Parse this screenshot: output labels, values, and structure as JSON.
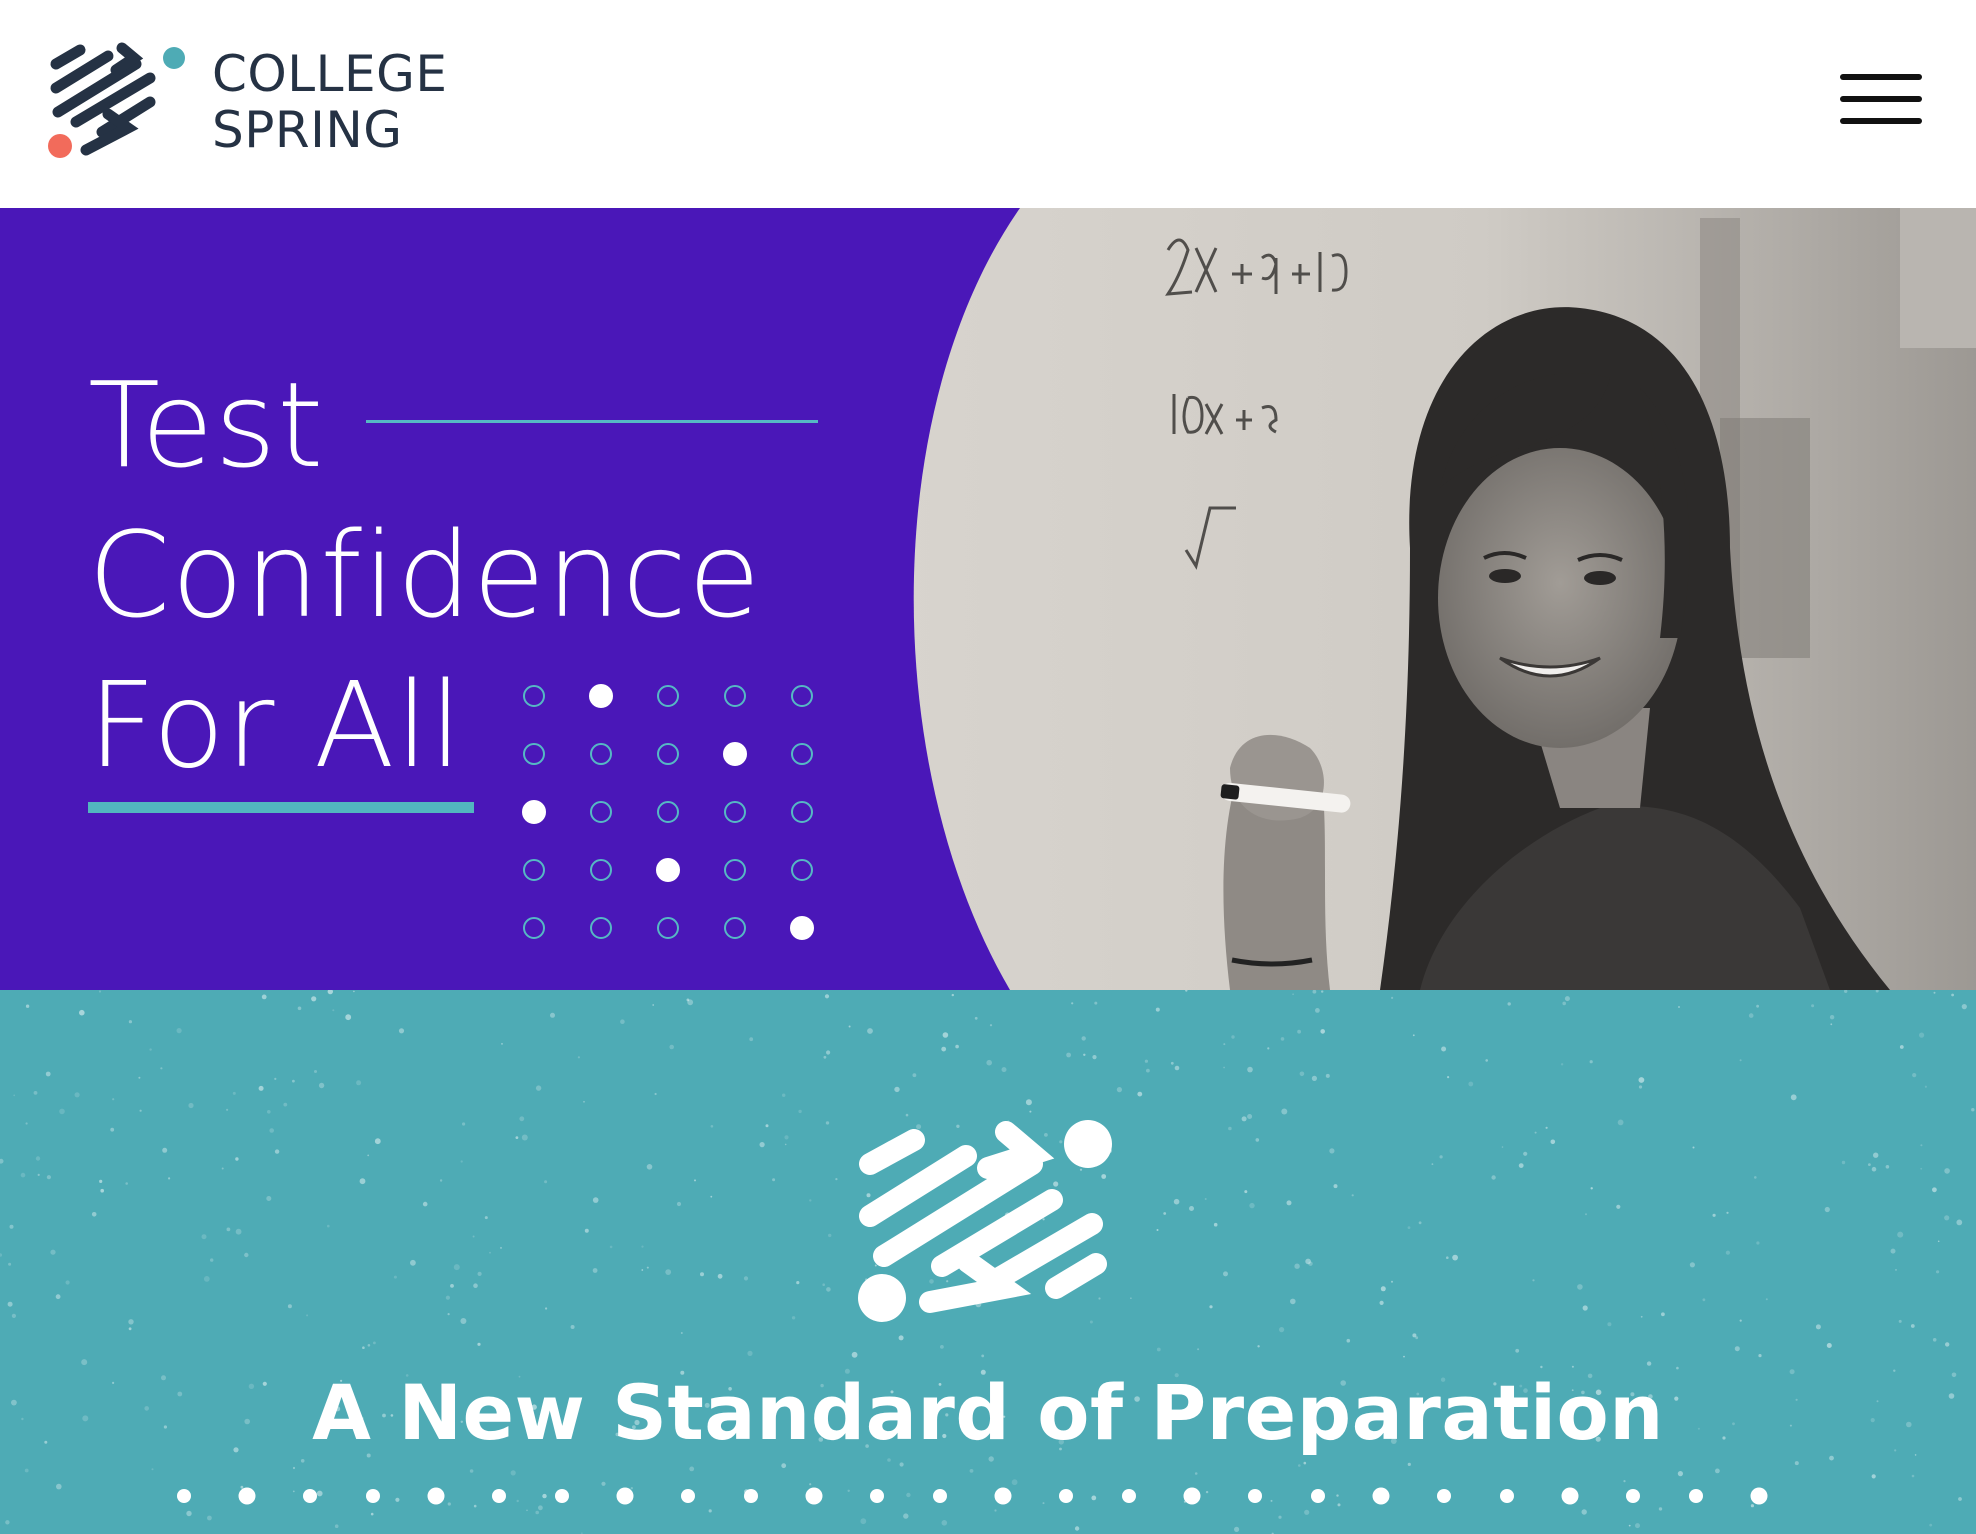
{
  "header": {
    "logo": {
      "line1": "COLLEGE",
      "line2": "SPRING",
      "icon": "college-spring-logo-icon"
    },
    "menu_icon": "hamburger-menu-icon"
  },
  "hero": {
    "title_line1": "Test",
    "title_line2": "Confidence",
    "title_line3": "For All",
    "photo": "student-at-whiteboard-photo",
    "filled_dots": [
      [
        0,
        1
      ],
      [
        1,
        3
      ],
      [
        2,
        0
      ],
      [
        3,
        2
      ],
      [
        4,
        4
      ]
    ]
  },
  "section": {
    "mark_icon": "college-spring-mark-icon",
    "heading": "A New Standard of Preparation"
  },
  "colors": {
    "brand_purple": "#4a17b8",
    "brand_teal": "#4eabb5",
    "accent_coral": "#f26b5b",
    "accent_cyan": "#52b6bf",
    "navy": "#253244"
  }
}
